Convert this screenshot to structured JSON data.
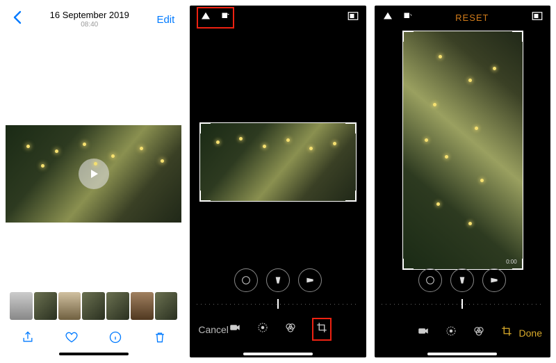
{
  "panel1": {
    "date": "16 September 2019",
    "time": "08:40",
    "edit_label": "Edit",
    "toolbar": {
      "share": "share-icon",
      "favorite": "heart-icon",
      "info": "info-icon",
      "delete": "trash-icon"
    }
  },
  "panel2": {
    "cancel_label": "Cancel",
    "header_icons": [
      "perspective-icon",
      "rotate-icon",
      "aspect-icon"
    ],
    "adjust_icons": [
      "straighten-icon",
      "vertical-perspective-icon",
      "horizontal-perspective-icon"
    ],
    "bottom_icons": [
      "video-icon",
      "adjust-icon",
      "filters-icon",
      "crop-icon"
    ],
    "highlighted": "crop-icon",
    "header_highlighted": true
  },
  "panel3": {
    "reset_label": "RESET",
    "done_label": "Done",
    "header_icons": [
      "perspective-icon",
      "rotate-icon",
      "aspect-icon"
    ],
    "adjust_icons": [
      "straighten-icon",
      "vertical-perspective-icon",
      "horizontal-perspective-icon"
    ],
    "bottom_icons": [
      "video-icon",
      "adjust-icon",
      "filters-icon",
      "crop-icon"
    ],
    "active_tool": "crop-icon",
    "timecode": "0:00"
  },
  "colors": {
    "ios_blue": "#007aff",
    "ios_orange": "#d17b1a",
    "ios_yellow": "#d8a92a",
    "highlight_red": "#e21"
  }
}
